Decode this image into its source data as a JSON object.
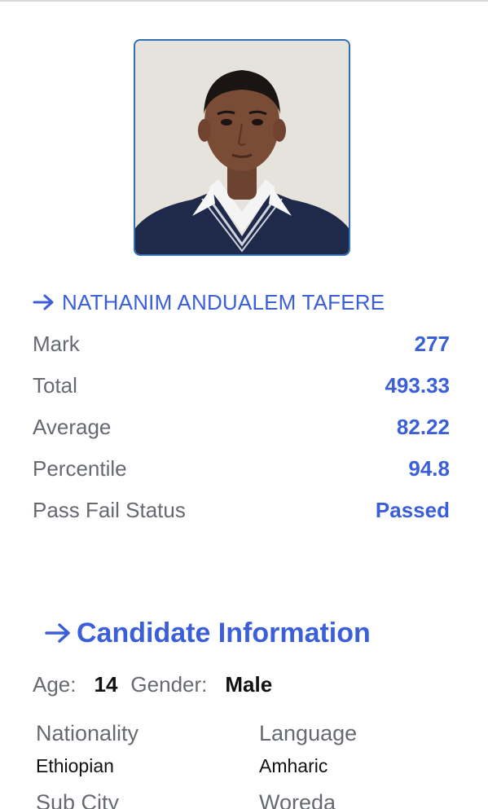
{
  "candidate": {
    "name": "NATHANIM ANDUALEM TAFERE",
    "photo_alt_name": "student-photo"
  },
  "results": {
    "rows": [
      {
        "label": "Mark",
        "value": "277"
      },
      {
        "label": "Total",
        "value": "493.33"
      },
      {
        "label": "Average",
        "value": "82.22"
      },
      {
        "label": "Percentile",
        "value": "94.8"
      },
      {
        "label": "Pass Fail Status",
        "value": "Passed"
      }
    ]
  },
  "info": {
    "heading": "Candidate Information",
    "age_label": "Age:",
    "age_value": "14",
    "gender_label": "Gender:",
    "gender_value": "Male",
    "nationality_label": "Nationality",
    "nationality_value": "Ethiopian",
    "language_label": "Language",
    "language_value": "Amharic",
    "subcity_label": "Sub City",
    "woreda_label": "Woreda"
  },
  "colors": {
    "accent": "#3a5fd9",
    "label": "#666a70",
    "frame": "#2f6fb2"
  },
  "icons": {
    "name_arrow": "arrow-right-icon",
    "section_arrow": "arrow-right-icon"
  }
}
